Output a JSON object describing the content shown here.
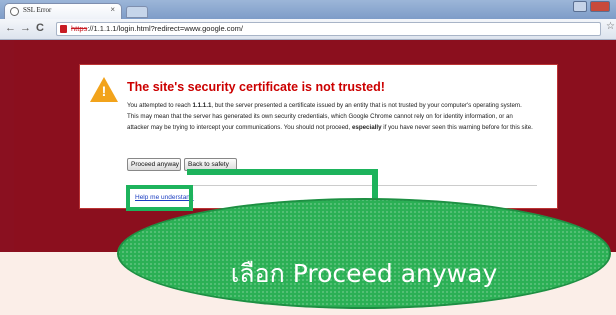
{
  "browser": {
    "tab_title": "SSL Error",
    "tab_close": "×",
    "back": "←",
    "forward": "→",
    "reload": "C",
    "url_scheme": "https",
    "url_rest": "://1.1.1.1/login.html?redirect=www.google.com/",
    "star": "☆"
  },
  "error_page": {
    "title": "The site's security certificate is not trusted!",
    "body_1": "You attempted to reach ",
    "body_host": "1.1.1.1",
    "body_2": ", but the server presented a certificate issued by an entity that is not trusted by your computer's operating system. This may mean that the server has generated its own security credentials, which Google Chrome cannot rely on for identity information, or an attacker may be trying to intercept your communications. You should not proceed, ",
    "body_especially": "especially",
    "body_3": " if you have never seen this warning before for this site.",
    "proceed_label": "Proceed anyway",
    "back_label": "Back to safety",
    "help_link": "Help me understand"
  },
  "annotation": {
    "text": "เลือก Proceed anyway",
    "color": "#2bb055"
  },
  "colors": {
    "page_background": "#8b0f1e",
    "title_red": "#cc0000",
    "warning_orange": "#f2a31b"
  }
}
